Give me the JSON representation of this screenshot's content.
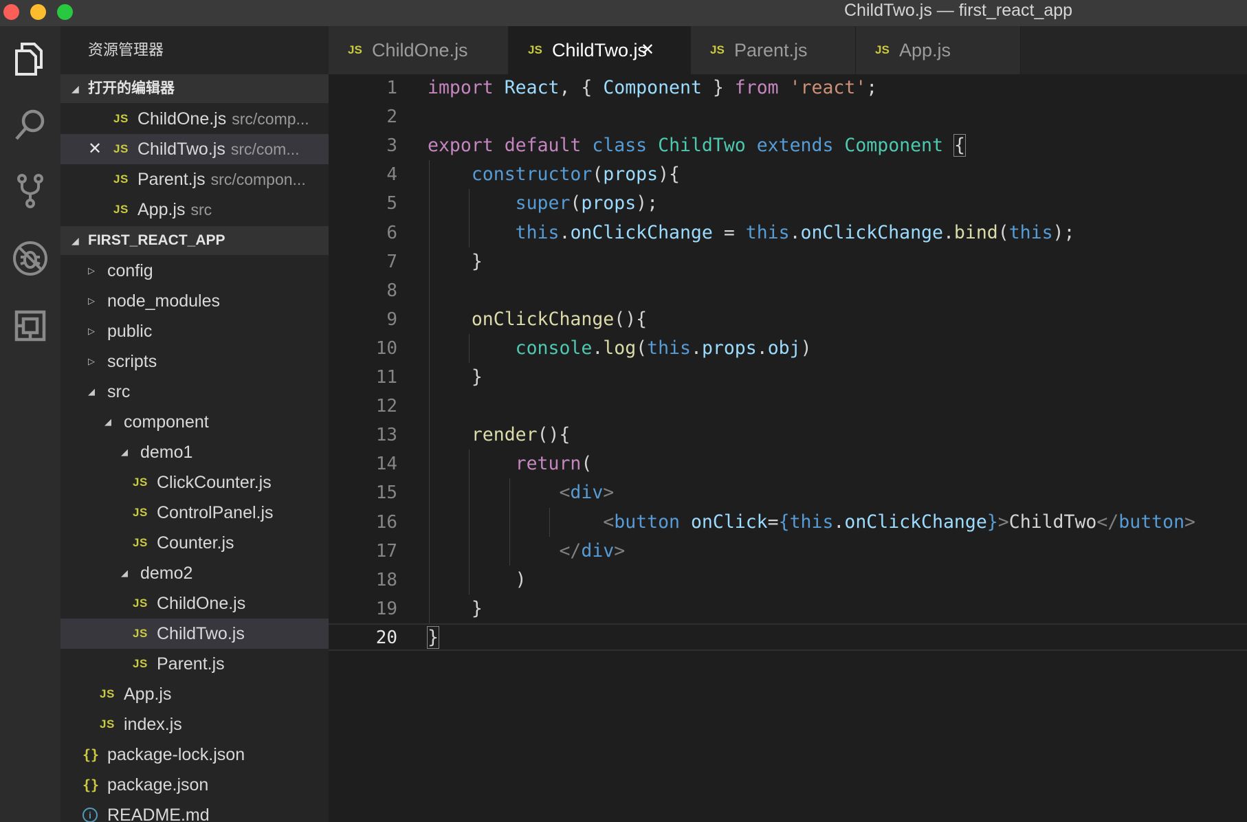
{
  "window": {
    "title": "ChildTwo.js — first_react_app"
  },
  "activity_bar": {
    "icons": [
      "explorer-icon",
      "search-icon",
      "source-control-icon",
      "debug-icon",
      "extensions-icon"
    ]
  },
  "sidebar": {
    "title": "资源管理器",
    "open_editors_header": "打开的编辑器",
    "open_editors": [
      {
        "name": "ChildOne.js",
        "path": "src/comp..."
      },
      {
        "name": "ChildTwo.js",
        "path": "src/com...",
        "close": "✕"
      },
      {
        "name": "Parent.js",
        "path": "src/compon..."
      },
      {
        "name": "App.js",
        "path": "src"
      }
    ],
    "project_header": "FIRST_REACT_APP",
    "tree": [
      {
        "label": "config",
        "type": "folder",
        "expanded": false
      },
      {
        "label": "node_modules",
        "type": "folder",
        "expanded": false
      },
      {
        "label": "public",
        "type": "folder",
        "expanded": false
      },
      {
        "label": "scripts",
        "type": "folder",
        "expanded": false
      },
      {
        "label": "src",
        "type": "folder",
        "expanded": true
      },
      {
        "label": "component",
        "type": "folder",
        "expanded": true
      },
      {
        "label": "demo1",
        "type": "folder",
        "expanded": true
      },
      {
        "label": "ClickCounter.js",
        "type": "js"
      },
      {
        "label": "ControlPanel.js",
        "type": "js"
      },
      {
        "label": "Counter.js",
        "type": "js"
      },
      {
        "label": "demo2",
        "type": "folder",
        "expanded": true
      },
      {
        "label": "ChildOne.js",
        "type": "js"
      },
      {
        "label": "ChildTwo.js",
        "type": "js",
        "selected": true
      },
      {
        "label": "Parent.js",
        "type": "js"
      },
      {
        "label": "App.js",
        "type": "js"
      },
      {
        "label": "index.js",
        "type": "js"
      },
      {
        "label": "package-lock.json",
        "type": "json"
      },
      {
        "label": "package.json",
        "type": "json"
      },
      {
        "label": "README.md",
        "type": "info"
      }
    ],
    "js_badge": "JS",
    "json_badge": "{}",
    "info_badge": "i"
  },
  "tabs": [
    {
      "label": "ChildOne.js",
      "active": false
    },
    {
      "label": "ChildTwo.js",
      "active": true,
      "close": "✕"
    },
    {
      "label": "Parent.js",
      "active": false
    },
    {
      "label": "App.js",
      "active": false
    }
  ],
  "editor": {
    "current_line": 20,
    "line_numbers": [
      "1",
      "2",
      "3",
      "4",
      "5",
      "6",
      "7",
      "8",
      "9",
      "10",
      "11",
      "12",
      "13",
      "14",
      "15",
      "16",
      "17",
      "18",
      "19",
      "20"
    ],
    "lines": [
      [
        [
          "kw",
          "import"
        ],
        [
          "pu",
          " "
        ],
        [
          "var",
          "React"
        ],
        [
          "pu",
          ", { "
        ],
        [
          "var",
          "Component"
        ],
        [
          "pu",
          " } "
        ],
        [
          "kw",
          "from"
        ],
        [
          "pu",
          " "
        ],
        [
          "str",
          "'react'"
        ],
        [
          "pu",
          ";"
        ]
      ],
      [],
      [
        [
          "kw",
          "export"
        ],
        [
          "pu",
          " "
        ],
        [
          "kw",
          "default"
        ],
        [
          "pu",
          " "
        ],
        [
          "kb",
          "class"
        ],
        [
          "pu",
          " "
        ],
        [
          "cls",
          "ChildTwo"
        ],
        [
          "pu",
          " "
        ],
        [
          "kb",
          "extends"
        ],
        [
          "pu",
          " "
        ],
        [
          "cls",
          "Component"
        ],
        [
          "pu",
          " "
        ],
        [
          "brk",
          "{"
        ]
      ],
      [
        [
          "pu",
          "    "
        ],
        [
          "kb",
          "constructor"
        ],
        [
          "pu",
          "("
        ],
        [
          "var",
          "props"
        ],
        [
          "pu",
          "){"
        ]
      ],
      [
        [
          "pu",
          "        "
        ],
        [
          "kb",
          "super"
        ],
        [
          "pu",
          "("
        ],
        [
          "var",
          "props"
        ],
        [
          "pu",
          ");"
        ]
      ],
      [
        [
          "pu",
          "        "
        ],
        [
          "kb",
          "this"
        ],
        [
          "pu",
          "."
        ],
        [
          "var",
          "onClickChange"
        ],
        [
          "pu",
          " = "
        ],
        [
          "kb",
          "this"
        ],
        [
          "pu",
          "."
        ],
        [
          "var",
          "onClickChange"
        ],
        [
          "pu",
          "."
        ],
        [
          "fn",
          "bind"
        ],
        [
          "pu",
          "("
        ],
        [
          "kb",
          "this"
        ],
        [
          "pu",
          ");"
        ]
      ],
      [
        [
          "pu",
          "    }"
        ]
      ],
      [],
      [
        [
          "pu",
          "    "
        ],
        [
          "fn",
          "onClickChange"
        ],
        [
          "pu",
          "(){"
        ]
      ],
      [
        [
          "pu",
          "        "
        ],
        [
          "cls",
          "console"
        ],
        [
          "pu",
          "."
        ],
        [
          "fn",
          "log"
        ],
        [
          "pu",
          "("
        ],
        [
          "kb",
          "this"
        ],
        [
          "pu",
          "."
        ],
        [
          "var",
          "props"
        ],
        [
          "pu",
          "."
        ],
        [
          "var",
          "obj"
        ],
        [
          "pu",
          ")"
        ]
      ],
      [
        [
          "pu",
          "    }"
        ]
      ],
      [],
      [
        [
          "pu",
          "    "
        ],
        [
          "fn",
          "render"
        ],
        [
          "pu",
          "(){"
        ]
      ],
      [
        [
          "pu",
          "        "
        ],
        [
          "kw",
          "return"
        ],
        [
          "pu",
          "("
        ]
      ],
      [
        [
          "pu",
          "            "
        ],
        [
          "ang",
          "<"
        ],
        [
          "tag",
          "div"
        ],
        [
          "ang",
          ">"
        ]
      ],
      [
        [
          "pu",
          "                "
        ],
        [
          "ang",
          "<"
        ],
        [
          "tag",
          "button"
        ],
        [
          "pu",
          " "
        ],
        [
          "attr",
          "onClick"
        ],
        [
          "pu",
          "="
        ],
        [
          "kb",
          "{"
        ],
        [
          "kb",
          "this"
        ],
        [
          "pu",
          "."
        ],
        [
          "var",
          "onClickChange"
        ],
        [
          "kb",
          "}"
        ],
        [
          "ang",
          ">"
        ],
        [
          "pu",
          "ChildTwo"
        ],
        [
          "ang",
          "</"
        ],
        [
          "tag",
          "button"
        ],
        [
          "ang",
          ">"
        ]
      ],
      [
        [
          "pu",
          "            "
        ],
        [
          "ang",
          "</"
        ],
        [
          "tag",
          "div"
        ],
        [
          "ang",
          ">"
        ]
      ],
      [
        [
          "pu",
          "        )"
        ]
      ],
      [
        [
          "pu",
          "    }"
        ]
      ],
      [
        [
          "brk",
          "}"
        ]
      ]
    ]
  }
}
